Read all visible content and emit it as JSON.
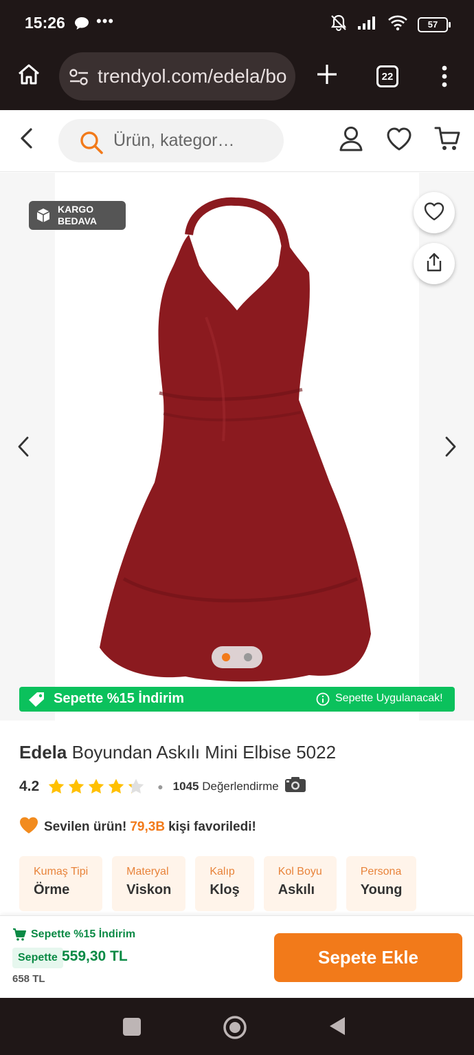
{
  "status_bar": {
    "time": "15:26",
    "dots": "•••",
    "battery": "57"
  },
  "browser": {
    "url": "trendyol.com/edela/bo",
    "tab_count": "22"
  },
  "header": {
    "search_placeholder": "Ürün, kategor…"
  },
  "gallery": {
    "badge_line1": "KARGO",
    "badge_line2": "BEDAVA",
    "discount_left": "Sepette %15 İndirim",
    "discount_right": "Sepette Uygulanacak!",
    "pager_total": 2,
    "pager_active": 1
  },
  "product": {
    "brand": "Edela",
    "name": "Boyundan Askılı Mini Elbise 5022",
    "rating": "4.2",
    "rating_value": 4.2,
    "review_count": "1045",
    "review_label": "Değerlendirme",
    "fav_prefix": "Sevilen ürün!",
    "fav_count": "79,3B",
    "fav_suffix": "kişi favoriledi!",
    "attributes": [
      {
        "key": "Kumaş Tipi",
        "value": "Örme"
      },
      {
        "key": "Materyal",
        "value": "Viskon"
      },
      {
        "key": "Kalıp",
        "value": "Kloş"
      },
      {
        "key": "Kol Boyu",
        "value": "Askılı"
      },
      {
        "key": "Persona",
        "value": "Young"
      }
    ]
  },
  "buy_bar": {
    "discount": "Sepette %15 İndirim",
    "price_label": "Sepette",
    "price": "559,30 TL",
    "old_price": "658 TL",
    "add_button": "Sepete Ekle"
  },
  "colors": {
    "brand_orange": "#f27a1a",
    "discount_green": "#0bc15c",
    "dress_red": "#8b1a1f"
  }
}
